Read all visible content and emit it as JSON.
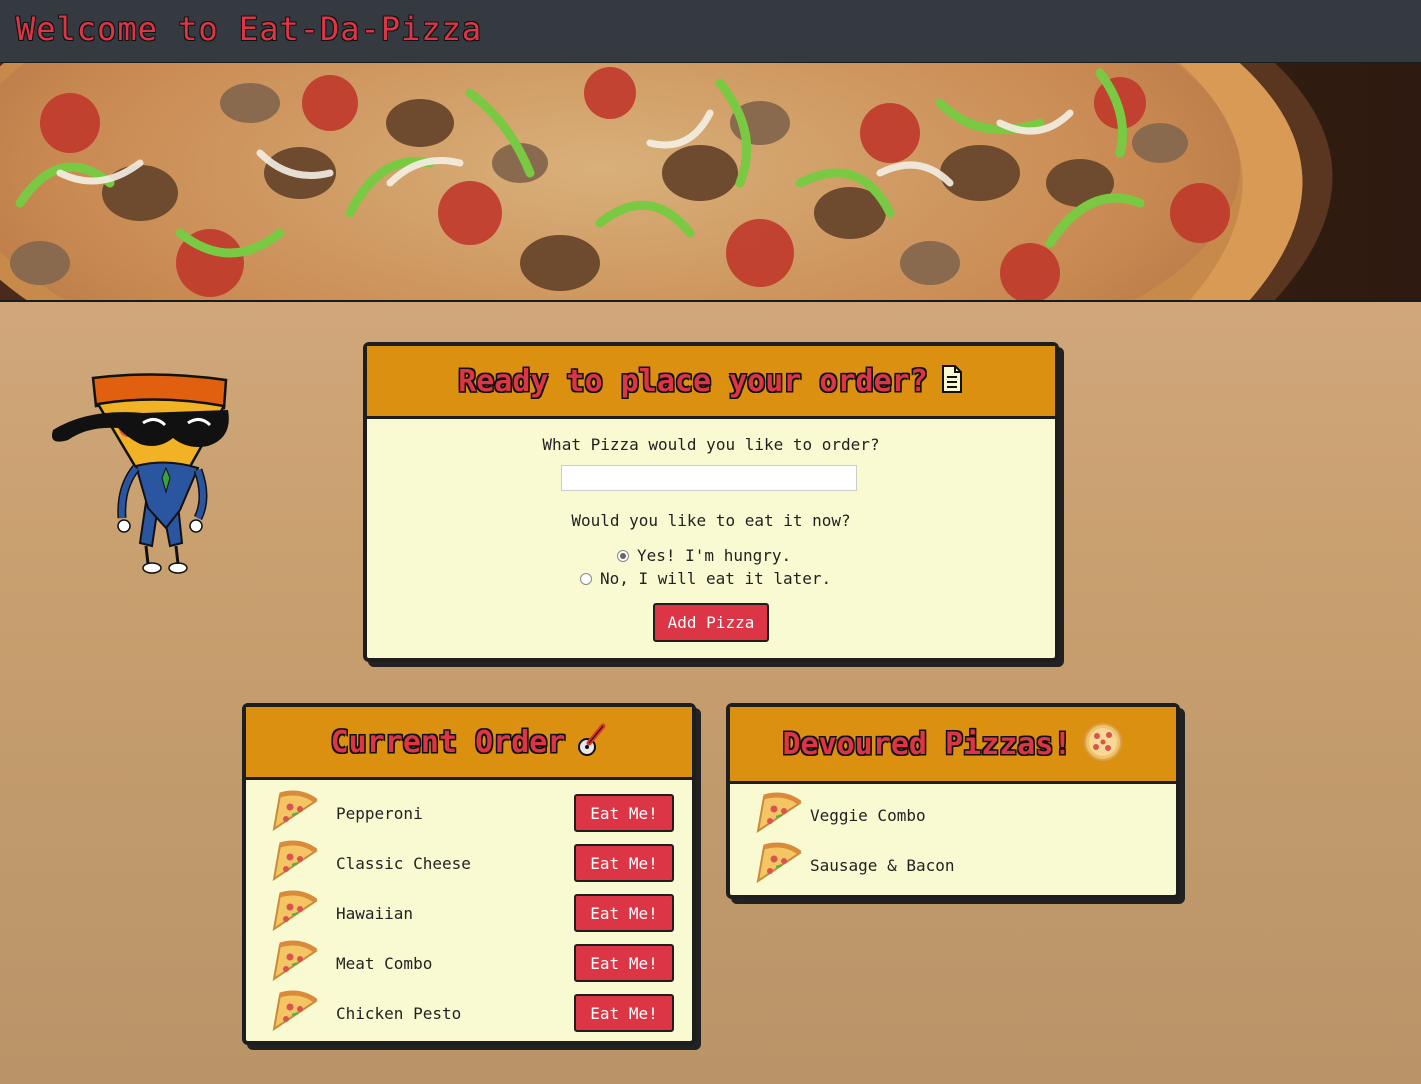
{
  "navbar": {
    "brand": "Welcome to Eat-Da-Pizza"
  },
  "order_form": {
    "title": "Ready to place your order?",
    "title_icon": "document-icon",
    "pizza_question": "What Pizza would you like to order?",
    "pizza_input_value": "",
    "eat_question": "Would you like to eat it now?",
    "options": [
      {
        "label": "Yes! I'm hungry.",
        "checked": true
      },
      {
        "label": "No, I will eat it later.",
        "checked": false
      }
    ],
    "submit_label": "Add Pizza"
  },
  "current_order": {
    "title": "Current Order",
    "title_icon": "pizza-cutter-icon",
    "eat_label": "Eat Me!",
    "items": [
      {
        "name": "Pepperoni"
      },
      {
        "name": "Classic Cheese"
      },
      {
        "name": "Hawaiian"
      },
      {
        "name": "Meat Combo"
      },
      {
        "name": "Chicken Pesto"
      }
    ]
  },
  "devoured": {
    "title": "Devoured Pizzas!",
    "title_icon": "pizza-icon",
    "items": [
      {
        "name": "Veggie Combo"
      },
      {
        "name": "Sausage & Bacon"
      }
    ]
  },
  "colors": {
    "navbar": "#343a40",
    "brand": "#dc3545",
    "panel_header": "#db9010",
    "panel_body": "#fafad2",
    "button": "#dc3545"
  }
}
